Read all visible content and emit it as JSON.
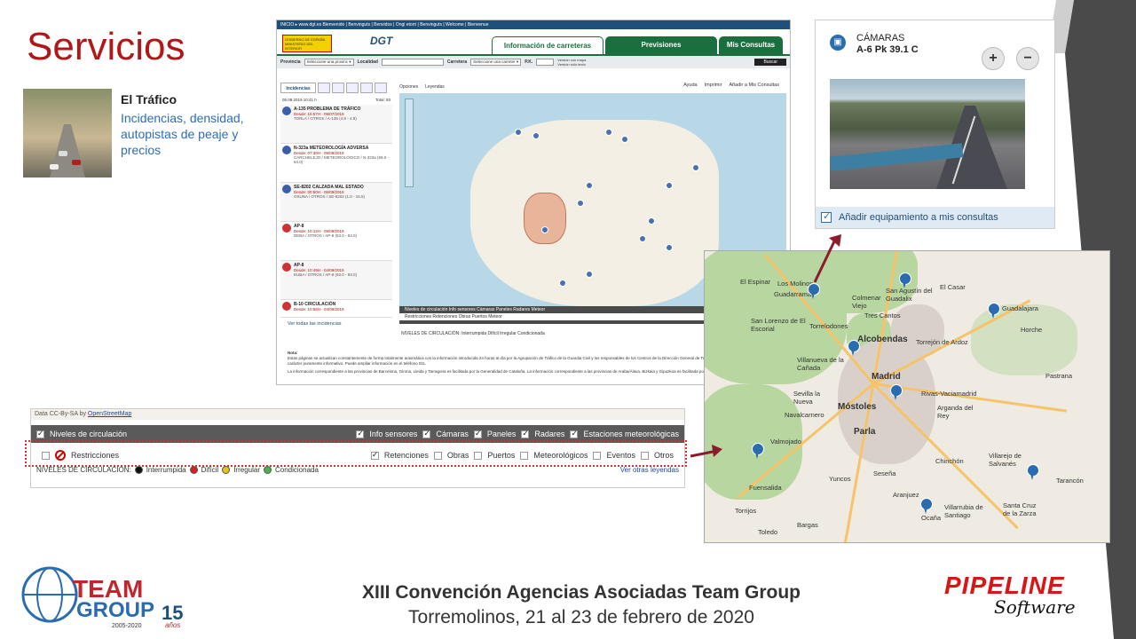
{
  "slide": {
    "title": "Servicios",
    "service": {
      "name": "El Tráfico",
      "description": "Incidencias, densidad, autopistas de peaje y precios"
    }
  },
  "dgt": {
    "topbar": "INICIO ▸ www.dgt.es   Bienvenido | Benvinguts | Benvidos | Ongi etorri | Benvinguts | Welcome | Bienvenue",
    "logo_gov": "GOBIERNO DE ESPAÑA  MINISTERIO DEL INTERIOR",
    "logo_dgt": "DGT",
    "tabs": [
      "Información de carreteras",
      "Previsiones",
      "Mis Consultas"
    ],
    "search": {
      "provincia_label": "Provincia",
      "provincia_value": "Seleccione una provinc ▾",
      "localidad_label": "Localidad",
      "carretera_label": "Carretera",
      "carretera_value": "Seleccione una carreter ▾",
      "pk_label": "P.K.",
      "opt1": "Versión con mapa",
      "opt2": "Versión sólo texto",
      "button": "Buscar"
    },
    "tools": {
      "options": "Opciones",
      "legends": "Leyendas",
      "help": "Ayuda",
      "print": "Imprimir",
      "add": "Añadir a Mis Consultas"
    },
    "incidents_tab": "Incidencias",
    "date": "05.09.2019 10:41 h",
    "total": "Total: 93",
    "incidents": [
      {
        "title": "A-135 PROBLEMA DE TRÁFICO",
        "since": "Desde: 16:57H - 09/07/2019",
        "sub": "TORLA / OTROS / A-135 (4.8 - 4.9)"
      },
      {
        "title": "N-323a METEOROLOGÍA ADVERSA",
        "since": "Desde: 07:30H - 09/09/2019",
        "sub": "CARCHELEJO / METEOROLÓGICO / N-323a (59.0 - 64.0)"
      },
      {
        "title": "SE-8202 CALZADA MAL ESTADO",
        "since": "Desde: 00:50H - 06/09/2019",
        "sub": "OSUNA / OTROS / SE-8202 (1.0 - 15.5)"
      },
      {
        "title": "AP-8",
        "since": "Desde: 10:12H - 09/09/2019",
        "sub": "DEBA / OTROS / AP-8 (53.0 - 53.0)"
      },
      {
        "title": "AP-8",
        "since": "Desde: 10:49H - 04/09/2019",
        "sub": "EUBA / OTROS / AP-8 (93.0 - 93.0)"
      },
      {
        "title": "B-10 CIRCULACIÓN",
        "since": "Desde: 10:56H - 04/09/2019",
        "sub": ""
      }
    ],
    "see_all": "Ver todas las incidencias",
    "map_credit": "Data CC-By-SA by OpenStreetMap",
    "map_footer_1": "Niveles de circulación   Info sensores   Cámaras   Paneles   Radares   Meteor",
    "map_footer_2": "Restricciones   Retenciones   Obras   Puertos   Meteor",
    "legend": "NIVELES DE CIRCULACIÓN:  Interrumpida   Difícil   Irregular   Condicionada",
    "note_title": "Nota:",
    "note_text": "Estas páginas se actualizan constantemente de forma totalmente automática con la información introducida 24 horas al día por la Agrupación de Tráfico de la Guardia Civil y los responsables de los Centros de la Dirección General de Tráfico. El contenido de estas páginas tiene carácter puramente informativo. Puede ampliar información en el teléfono 011.",
    "note_text2": "La información correspondiente a las provincias de Barcelona, Girona, Lleida y Tarragona es facilitada por la Generalidad de Cataluña. La información correspondiente a las provincias de Araba/Álava, Bizkaia y Gipuzkoa es facilitada por el Gobierno Vasco."
  },
  "legend_panel": {
    "credit_prefix": "Data CC-By-SA by",
    "credit_link": "OpenStreetMap",
    "row1": [
      {
        "label": "Niveles de circulación",
        "checked": true
      },
      {
        "label": "Info sensores",
        "checked": true
      },
      {
        "label": "Cámaras",
        "checked": true
      },
      {
        "label": "Paneles",
        "checked": true
      },
      {
        "label": "Radares",
        "checked": true
      },
      {
        "label": "Estaciones meteorológicas",
        "checked": true
      }
    ],
    "restricciones": "Restricciones",
    "row2": [
      {
        "label": "Retenciones",
        "checked": true
      },
      {
        "label": "Obras",
        "checked": false
      },
      {
        "label": "Puertos",
        "checked": false
      },
      {
        "label": "Meteorológicos",
        "checked": false
      },
      {
        "label": "Eventos",
        "checked": false
      },
      {
        "label": "Otros",
        "checked": false
      }
    ],
    "levels_label": "NIVELES DE CIRCULACIÓN:",
    "levels": [
      {
        "label": "Interrumpida",
        "color": "#111111"
      },
      {
        "label": "Difícil",
        "color": "#d42020"
      },
      {
        "label": "Irregular",
        "color": "#e8c21a"
      },
      {
        "label": "Condicionada",
        "color": "#4caf50"
      }
    ],
    "more": "Ver otras leyendas"
  },
  "camera": {
    "label": "CÁMARAS",
    "location": "A-6 Pk 39.1 C",
    "zoom_in": "+",
    "zoom_out": "−",
    "add": "Añadir equipamiento a mis consultas"
  },
  "madrid_map": {
    "cities": [
      {
        "name": "El Espinar",
        "big": false
      },
      {
        "name": "Los Molinos",
        "big": false
      },
      {
        "name": "Guadarrama",
        "big": false
      },
      {
        "name": "San Agustín del Guadalix",
        "big": false
      },
      {
        "name": "El Casar",
        "big": false
      },
      {
        "name": "Guadalajara",
        "big": false
      },
      {
        "name": "Colmenar Viejo",
        "big": false
      },
      {
        "name": "San Lorenzo de El Escorial",
        "big": false
      },
      {
        "name": "Torrelodones",
        "big": false
      },
      {
        "name": "Tres Cantos",
        "big": false
      },
      {
        "name": "Alcobendas",
        "big": true
      },
      {
        "name": "Torrejón de Ardoz",
        "big": false
      },
      {
        "name": "Horche",
        "big": false
      },
      {
        "name": "Villanueva de la Cañada",
        "big": false
      },
      {
        "name": "Madrid",
        "big": true
      },
      {
        "name": "Pastrana",
        "big": false
      },
      {
        "name": "Sevilla la Nueva",
        "big": false
      },
      {
        "name": "Rivas-Vaciamadrid",
        "big": false
      },
      {
        "name": "Navalcarnero",
        "big": false
      },
      {
        "name": "Móstoles",
        "big": true
      },
      {
        "name": "Arganda del Rey",
        "big": false
      },
      {
        "name": "Parla",
        "big": false
      },
      {
        "name": "Valmojado",
        "big": false
      },
      {
        "name": "Chinchón",
        "big": false
      },
      {
        "name": "Villarejo de Salvanés",
        "big": false
      },
      {
        "name": "Yuncos",
        "big": false
      },
      {
        "name": "Seseña",
        "big": false
      },
      {
        "name": "Fuensalida",
        "big": false
      },
      {
        "name": "Aranjuez",
        "big": false
      },
      {
        "name": "Tarancón",
        "big": false
      },
      {
        "name": "Villarrubia de Santiago",
        "big": false
      },
      {
        "name": "Santa Cruz de la Zarza",
        "big": false
      },
      {
        "name": "Torrijos",
        "big": false
      },
      {
        "name": "Toledo",
        "big": false
      },
      {
        "name": "Ocaña",
        "big": false
      },
      {
        "name": "Bargas",
        "big": false
      }
    ]
  },
  "footer": {
    "team_line1": "TEAM",
    "team_line2": "GROUP",
    "team_years": "2005-2020",
    "team_anniv": "15",
    "team_anniv_sub": "años",
    "title": "XIII Convención  Agencias Asociadas Team Group",
    "subtitle": "Torremolinos, 21 al 23 de febrero de 2020",
    "pipeline": "PIPELINE",
    "software": "Software"
  },
  "colors": {
    "title_red": "#b01818",
    "link_blue": "#2e6db4",
    "dgt_green": "#1b6e3e",
    "arrow": "#8b1c2c"
  }
}
